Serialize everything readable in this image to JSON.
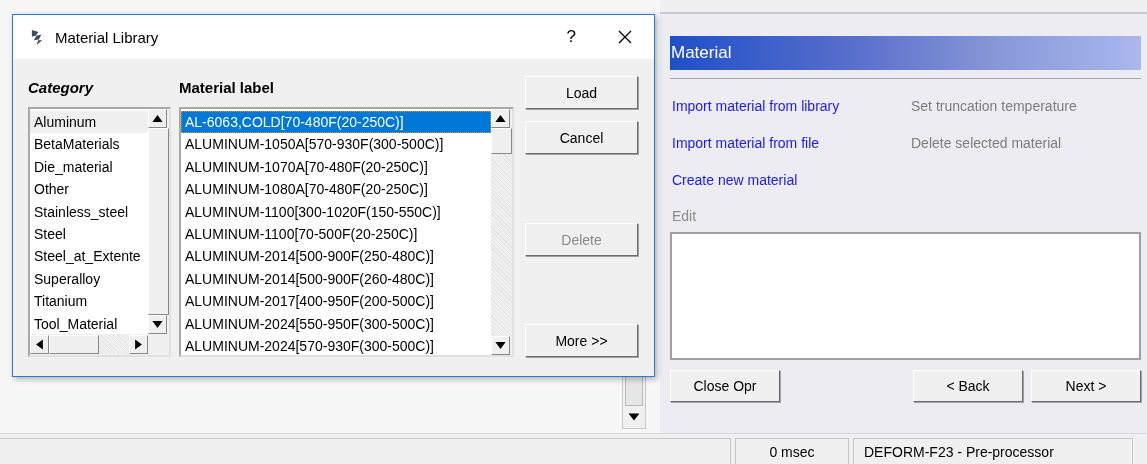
{
  "dialog": {
    "title": "Material Library",
    "help": "?",
    "category_heading": "Category",
    "material_heading": "Material label",
    "categories": [
      {
        "label": "Aluminum",
        "selected": true
      },
      {
        "label": "BetaMaterials",
        "selected": false
      },
      {
        "label": "Die_material",
        "selected": false
      },
      {
        "label": "Other",
        "selected": false
      },
      {
        "label": "Stainless_steel",
        "selected": false
      },
      {
        "label": "Steel",
        "selected": false
      },
      {
        "label": "Steel_at_Extente",
        "selected": false
      },
      {
        "label": "Superalloy",
        "selected": false
      },
      {
        "label": "Titanium",
        "selected": false
      },
      {
        "label": "Tool_Material",
        "selected": false
      }
    ],
    "materials": [
      {
        "label": "AL-6063,COLD[70-480F(20-250C)]",
        "selected": true
      },
      {
        "label": "ALUMINUM-1050A[570-930F(300-500C)]",
        "selected": false
      },
      {
        "label": "ALUMINUM-1070A[70-480F(20-250C)]",
        "selected": false
      },
      {
        "label": "ALUMINUM-1080A[70-480F(20-250C)]",
        "selected": false
      },
      {
        "label": "ALUMINUM-1100[300-1020F(150-550C)]",
        "selected": false
      },
      {
        "label": "ALUMINUM-1100[70-500F(20-250C)]",
        "selected": false
      },
      {
        "label": "ALUMINUM-2014[500-900F(250-480C)]",
        "selected": false
      },
      {
        "label": "ALUMINUM-2014[500-900F(260-480C)]",
        "selected": false
      },
      {
        "label": "ALUMINUM-2017[400-950F(200-500C)]",
        "selected": false
      },
      {
        "label": "ALUMINUM-2024[550-950F(300-500C)]",
        "selected": false
      },
      {
        "label": "ALUMINUM-2024[570-930F(300-500C)]",
        "selected": false
      }
    ],
    "buttons": [
      {
        "label": "Load",
        "disabled": false
      },
      {
        "label": "Cancel",
        "disabled": false
      },
      {
        "label": "Delete",
        "disabled": true
      },
      {
        "label": "More >>",
        "disabled": false
      }
    ]
  },
  "panel": {
    "title": "Material",
    "actions": [
      {
        "label": "Import material from library",
        "disabled": false
      },
      {
        "label": "Set truncation temperature",
        "disabled": true
      },
      {
        "label": "Import material from file",
        "disabled": false
      },
      {
        "label": "Delete selected material",
        "disabled": true
      },
      {
        "label": "Create new material",
        "disabled": false
      }
    ],
    "edit_label": "Edit",
    "buttons": [
      {
        "label": "Close Opr"
      },
      {
        "label": "< Back"
      },
      {
        "label": "Next >"
      }
    ]
  },
  "status_bar": [
    "0 msec",
    "DEFORM-F23  -  Pre-processor"
  ]
}
